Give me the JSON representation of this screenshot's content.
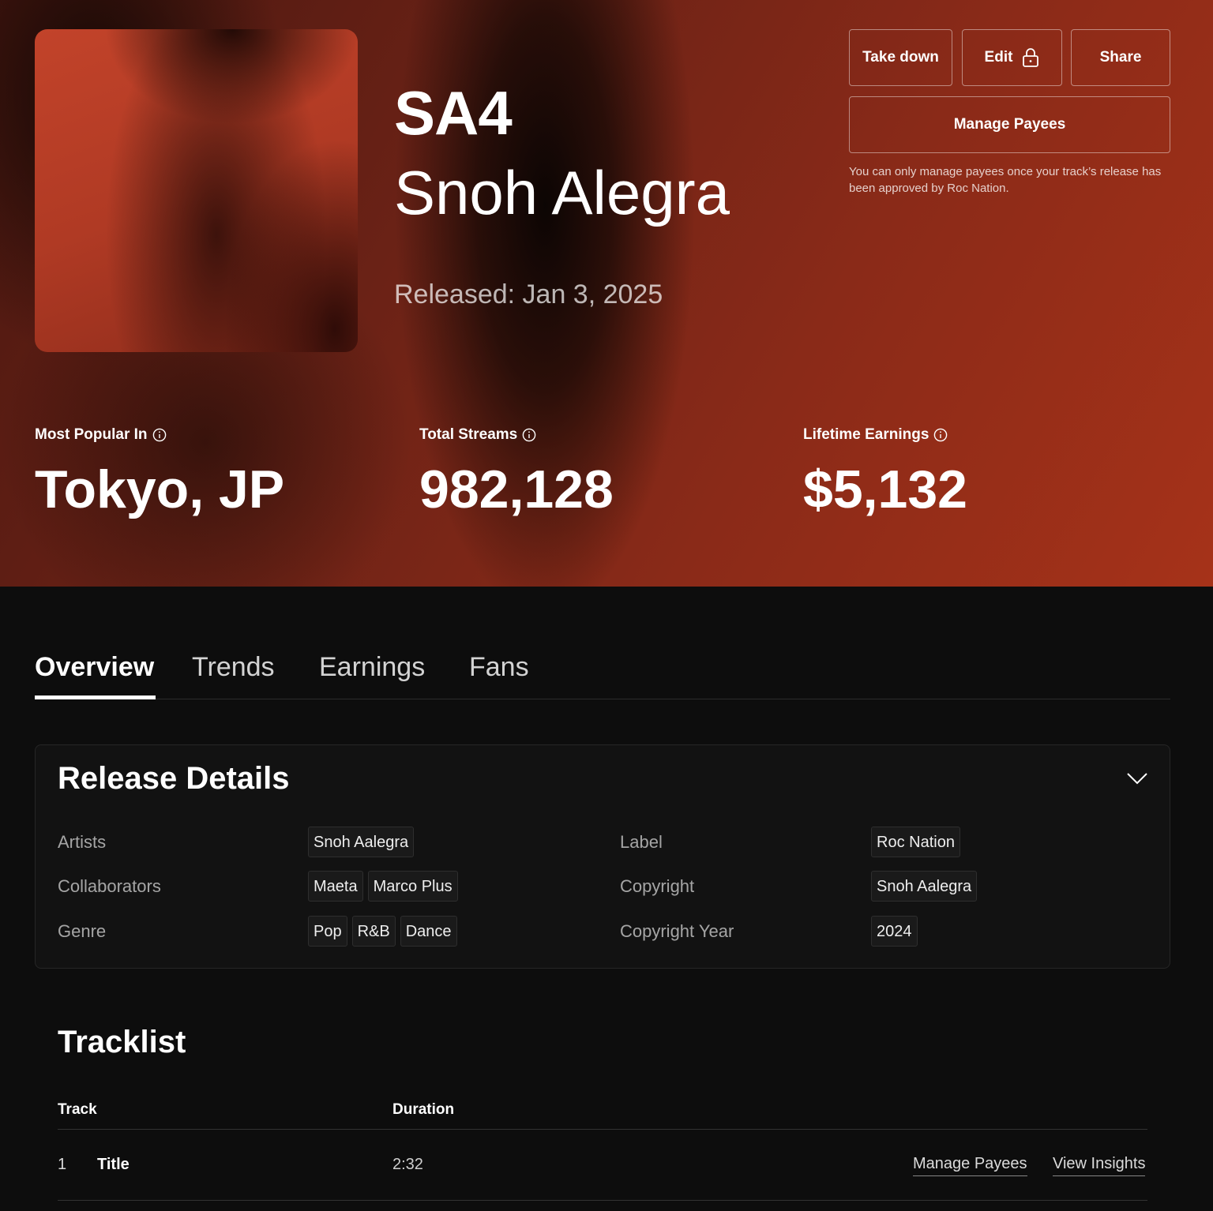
{
  "hero": {
    "album_title": "SA4",
    "artist": "Snoh Alegra",
    "released": "Released: Jan 3, 2025"
  },
  "actions": {
    "take_down": "Take down",
    "edit": "Edit",
    "share": "Share",
    "manage_payees": "Manage Payees",
    "note": "You can only manage payees once your track’s release has been approved by Roc Nation."
  },
  "stats": [
    {
      "label": "Most Popular In",
      "value": "Tokyo, JP"
    },
    {
      "label": "Total Streams",
      "value": "982,128"
    },
    {
      "label": "Lifetime Earnings",
      "value": "$5,132"
    }
  ],
  "tabs": [
    {
      "label": "Overview",
      "active": true
    },
    {
      "label": "Trends",
      "active": false
    },
    {
      "label": "Earnings",
      "active": false
    },
    {
      "label": "Fans",
      "active": false
    }
  ],
  "release_details": {
    "title": "Release Details",
    "artists_label": "Artists",
    "artists": [
      "Snoh Aalegra"
    ],
    "collaborators_label": "Collaborators",
    "collaborators": [
      "Maeta",
      "Marco Plus"
    ],
    "genre_label": "Genre",
    "genres": [
      "Pop",
      "R&B",
      "Dance"
    ],
    "label_label": "Label",
    "label": [
      "Roc Nation"
    ],
    "copyright_label": "Copyright",
    "copyright": [
      "Snoh Aalegra"
    ],
    "copyright_year_label": "Copyright Year",
    "copyright_year": [
      "2024"
    ]
  },
  "tracklist": {
    "title": "Tracklist",
    "columns": {
      "track": "Track",
      "duration": "Duration"
    },
    "rows": [
      {
        "number": "1",
        "title": "Title",
        "duration": "2:32",
        "manage_payees": "Manage Payees",
        "view_insights": "View Insights"
      }
    ]
  }
}
